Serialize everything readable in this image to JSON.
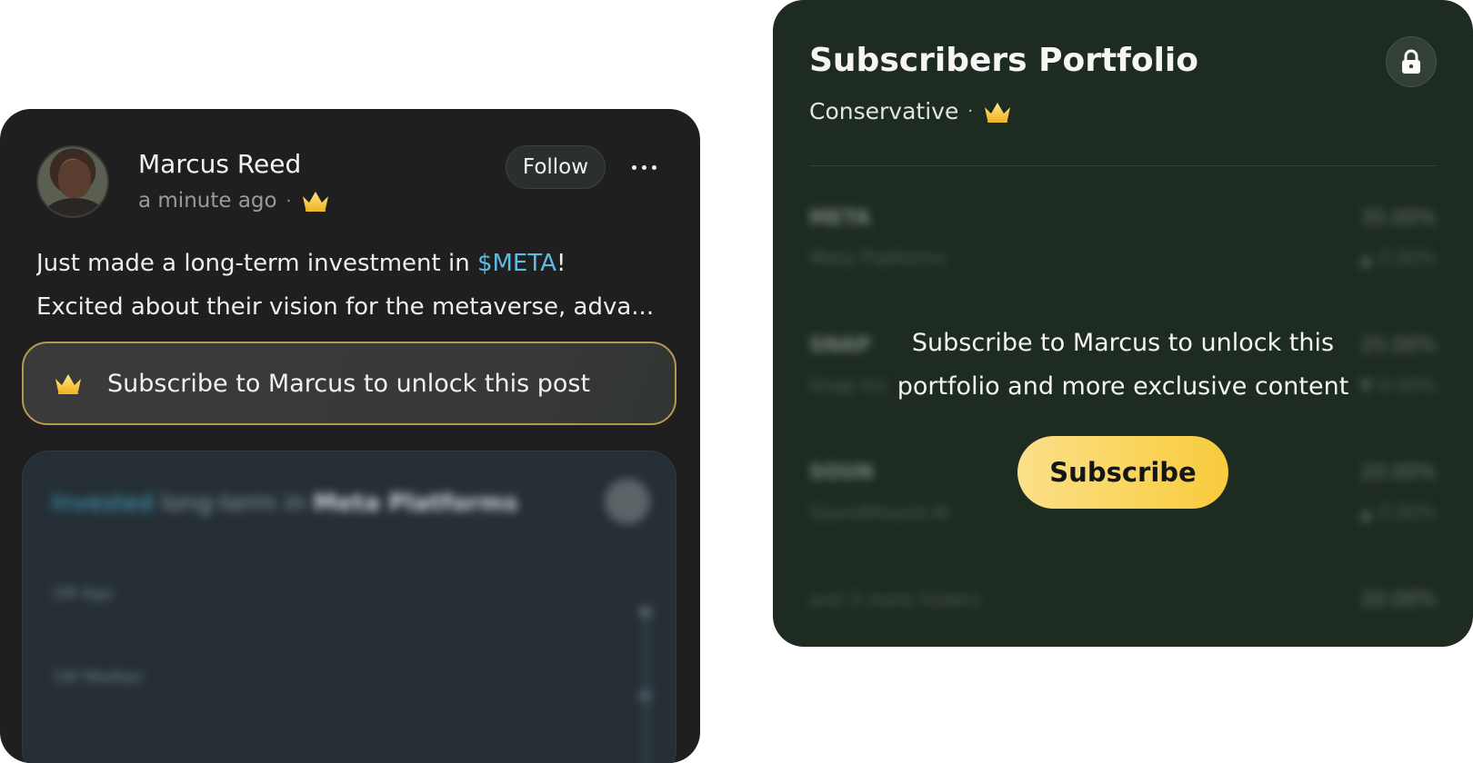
{
  "post": {
    "author_name": "Marcus Reed",
    "timestamp": "a minute ago",
    "separator": "·",
    "follow_label": "Follow",
    "more_icon": "more-horizontal-icon",
    "text_before": "Just made a long-term investment in ",
    "ticker": "$META",
    "text_after": "!",
    "text_line2": "Excited about their vision for the metaverse, adva...",
    "unlock_text": "Subscribe to Marcus to unlock this post",
    "blurred_preview": {
      "title_part1": "Invested",
      "title_part2": " long-term in ",
      "title_part3": "Meta Platforms",
      "row1_label": "1M Ago",
      "row2_label": "1W Median"
    }
  },
  "portfolio": {
    "title": "Subscribers Portfolio",
    "risk_level": "Conservative",
    "separator": "·",
    "lock_icon": "lock-icon",
    "locked_message_line1": "Subscribe to Marcus to unlock this",
    "locked_message_line2": "portfolio and more exclusive content",
    "subscribe_label": "Subscribe",
    "blurred_holdings": [
      {
        "symbol": "META",
        "name": "Meta Platforms",
        "percent": "35.00%",
        "change": "▲ 0.00%"
      },
      {
        "symbol": "SNAP",
        "name": "Snap Inc",
        "percent": "25.00%",
        "change": "▼ 0.00%"
      },
      {
        "symbol": "SOUN",
        "name": "SoundHound AI",
        "percent": "20.00%",
        "change": "▲ 0.00%"
      },
      {
        "symbol": "",
        "name": "and 3 more tickers",
        "percent": "20.00%",
        "change": ""
      }
    ]
  },
  "colors": {
    "ticker": "#5bbde6",
    "crown": "#f7c844",
    "subscribe_gradient_start": "#fbe08a",
    "subscribe_gradient_end": "#f8cb3b",
    "portfolio_bg": "#1e2b20",
    "post_bg": "#1f1f1f"
  }
}
